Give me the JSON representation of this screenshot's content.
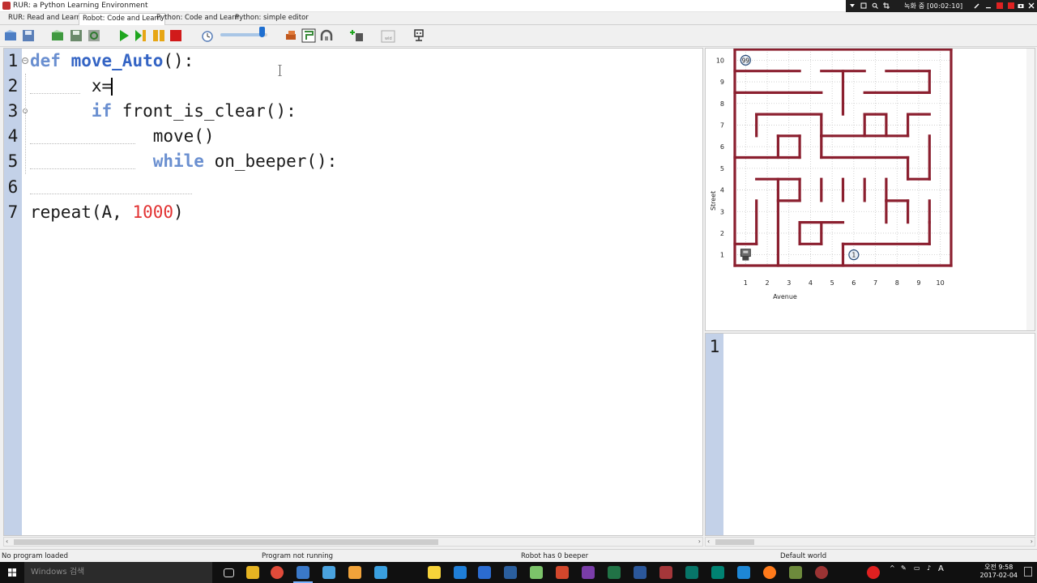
{
  "window": {
    "title": "RUR: a Python Learning Environment",
    "recording": {
      "status": "녹화 중 [00:02:10]"
    }
  },
  "tabs": [
    {
      "label": "RUR: Read and Learn",
      "active": false
    },
    {
      "label": "Robot: Code and Learn",
      "active": true
    },
    {
      "label": "Python: Code and Learn",
      "active": false
    },
    {
      "label": "Python: simple editor",
      "active": false
    }
  ],
  "toolbar": {
    "icons": [
      "open-world-icon",
      "save-world-icon",
      "open-program-icon",
      "save-program-icon",
      "reload-icon",
      "run-icon",
      "step-icon",
      "pause-icon",
      "stop-icon",
      "clock-icon",
      "speed-slider",
      "beeper-icon",
      "world-builder-icon",
      "robot-icon",
      "add-beeper-icon",
      "edit-walls-icon",
      "help-robot-icon"
    ],
    "speed_fraction": 0.88
  },
  "editor": {
    "line_numbers": [
      "1",
      "2",
      "3",
      "4",
      "5",
      "6",
      "7"
    ],
    "lines": [
      {
        "tokens": [
          {
            "t": "def",
            "c": "kw"
          },
          {
            "t": " ",
            "c": ""
          },
          {
            "t": "move_Auto",
            "c": "fn"
          },
          {
            "t": "():",
            "c": ""
          }
        ]
      },
      {
        "tokens": [
          {
            "t": "      x=",
            "c": ""
          }
        ]
      },
      {
        "tokens": [
          {
            "t": "      ",
            "c": ""
          },
          {
            "t": "if",
            "c": "kw"
          },
          {
            "t": " front_is_clear():",
            "c": ""
          }
        ]
      },
      {
        "tokens": [
          {
            "t": "            move()",
            "c": ""
          }
        ]
      },
      {
        "tokens": [
          {
            "t": "            ",
            "c": ""
          },
          {
            "t": "while",
            "c": "kw"
          },
          {
            "t": " on_beeper():",
            "c": ""
          }
        ]
      },
      {
        "tokens": [
          {
            "t": "",
            "c": ""
          }
        ]
      },
      {
        "tokens": [
          {
            "t": "repeat(A, ",
            "c": ""
          },
          {
            "t": "1000",
            "c": "num"
          },
          {
            "t": ")",
            "c": ""
          }
        ]
      }
    ]
  },
  "world": {
    "street_label": "Street",
    "avenue_label": "Avenue",
    "x_ticks": [
      "1",
      "2",
      "3",
      "4",
      "5",
      "6",
      "7",
      "8",
      "9",
      "10"
    ],
    "y_ticks": [
      "1",
      "2",
      "3",
      "4",
      "5",
      "6",
      "7",
      "8",
      "9",
      "10"
    ],
    "beepers": [
      {
        "avenue": 1,
        "street": 10,
        "count": "99"
      },
      {
        "avenue": 6,
        "street": 1,
        "count": "1"
      }
    ],
    "robot": {
      "avenue": 1,
      "street": 1
    }
  },
  "output": {
    "line_numbers": [
      "1"
    ]
  },
  "status": {
    "program_file": "No program loaded",
    "program_state": "Program not running",
    "robot_beepers": "Robot has 0 beeper",
    "world_file": "Default world"
  },
  "taskbar": {
    "search_placeholder": "Windows 검색",
    "apps": [
      "task-view-icon",
      "file-explorer-icon",
      "chrome-icon",
      "rur-app-icon",
      "feather-icon",
      "slides-icon",
      "paint-icon",
      "kakaotalk-icon",
      "edge-icon",
      "ie-icon",
      "python-icon",
      "android-icon",
      "powerpoint-icon",
      "onenote-icon",
      "excel-icon",
      "word-icon",
      "access-icon",
      "publisher-icon",
      "sway-icon",
      "store-icon",
      "firefox-icon",
      "minecraft-icon",
      "spiral-icon",
      "record-icon"
    ],
    "time": "오전 9:58",
    "date": "2017-02-04",
    "ime": "A"
  },
  "colors": {
    "wall": "#8b1f2f",
    "gutter": "#c3d1e8",
    "keyword": "#6a8fd0",
    "function": "#3464c4",
    "number": "#e23232"
  }
}
